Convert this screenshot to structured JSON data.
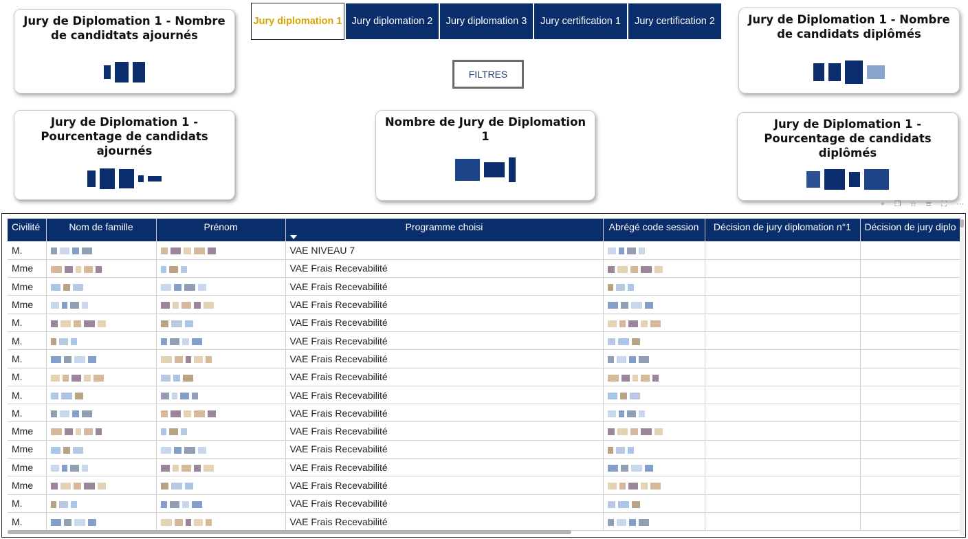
{
  "tabs": [
    {
      "label": "Jury diplomation 1",
      "active": true
    },
    {
      "label": "Jury diplomation 2",
      "active": false
    },
    {
      "label": "Jury diplomation 3",
      "active": false
    },
    {
      "label": "Jury certification 1",
      "active": false
    },
    {
      "label": "Jury certification 2",
      "active": false
    }
  ],
  "filter_button": "FILTRES",
  "cards": {
    "ajournes_count_title": "Jury de Diplomation 1 - Nombre de candidtats ajournés",
    "diplomes_count_title": "Jury de Diplomation 1 - Nombre de candidats diplômés",
    "ajournes_pct_title": "Jury de Diplomation 1 - Pourcentage de candidats ajournés",
    "jury_count_title": "Nombre de Jury de Diplomation 1",
    "diplomes_pct_title": "Jury de Diplomation 1 - Pourcentage de candidats diplômés"
  },
  "visual_tools": [
    "pin-icon",
    "copy-icon",
    "bell-icon",
    "filter-icon",
    "focus-icon",
    "more-icon"
  ],
  "table": {
    "headers": [
      "Civilité",
      "Nom de famille",
      "Prénom",
      "Programme choisi",
      "Abrégé code session",
      "Décision de jury diplomation n°1",
      "Décision de jury diplo"
    ],
    "rows": [
      {
        "civilite": "M.",
        "programme": "VAE NIVEAU 7"
      },
      {
        "civilite": "Mme",
        "programme": "VAE Frais Recevabilité"
      },
      {
        "civilite": "Mme",
        "programme": "VAE Frais Recevabilité"
      },
      {
        "civilite": "Mme",
        "programme": "VAE Frais Recevabilité"
      },
      {
        "civilite": "M.",
        "programme": "VAE Frais Recevabilité"
      },
      {
        "civilite": "M.",
        "programme": "VAE Frais Recevabilité"
      },
      {
        "civilite": "M.",
        "programme": "VAE Frais Recevabilité"
      },
      {
        "civilite": "M.",
        "programme": "VAE Frais Recevabilité"
      },
      {
        "civilite": "M.",
        "programme": "VAE Frais Recevabilité"
      },
      {
        "civilite": "M.",
        "programme": "VAE Frais Recevabilité"
      },
      {
        "civilite": "Mme",
        "programme": "VAE Frais Recevabilité"
      },
      {
        "civilite": "Mme",
        "programme": "VAE Frais Recevabilité"
      },
      {
        "civilite": "Mme",
        "programme": "VAE Frais Recevabilité"
      },
      {
        "civilite": "Mme",
        "programme": "VAE Frais Recevabilité"
      },
      {
        "civilite": "M.",
        "programme": "VAE Frais Recevabilité"
      },
      {
        "civilite": "M.",
        "programme": "VAE Frais Recevabilité"
      }
    ]
  },
  "colors": {
    "primary": "#0a2d6c",
    "active_tab_text": "#d7a400"
  }
}
